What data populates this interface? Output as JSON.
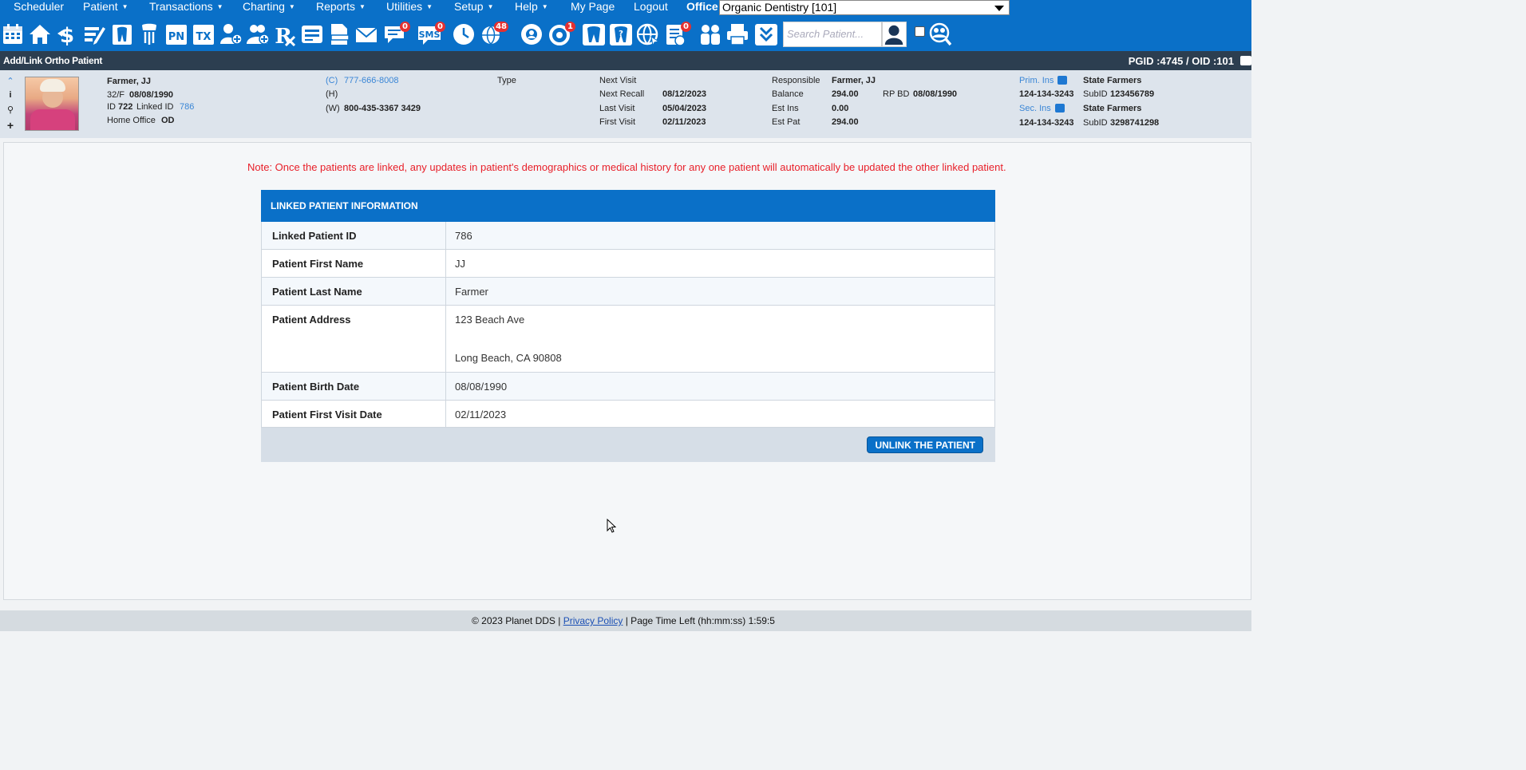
{
  "menu": {
    "items": [
      {
        "label": "Scheduler",
        "caret": false
      },
      {
        "label": "Patient",
        "caret": true
      },
      {
        "label": "Transactions",
        "caret": true
      },
      {
        "label": "Charting",
        "caret": true
      },
      {
        "label": "Reports",
        "caret": true
      },
      {
        "label": "Utilities",
        "caret": true
      },
      {
        "label": "Setup",
        "caret": true
      },
      {
        "label": "Help",
        "caret": true
      },
      {
        "label": "My Page",
        "caret": false
      },
      {
        "label": "Logout",
        "caret": false
      }
    ],
    "office_label": "Office",
    "office_value": "Organic Dentistry [101]"
  },
  "toolbar": {
    "icons": [
      "calendar-icon",
      "home-icon",
      "dollar-icon",
      "edit-icon",
      "tooth-chart-icon",
      "implant-icon",
      "pn-icon",
      "tx-icon",
      "add-patient-icon",
      "family-add-icon",
      "rx-icon",
      "notes-icon",
      "document-icon",
      "mail-icon",
      "chat-icon",
      "sms-icon",
      "clock-icon",
      "globe-users-icon",
      "support-icon",
      "refresh-icon",
      "tooth-icon",
      "tooth-question-icon",
      "web-icon",
      "checklist-icon",
      "people-icon",
      "printer-icon",
      "chevron-down-icon"
    ],
    "pn_text": "PN",
    "tx_text": "TX",
    "sms_text": "SMS",
    "badges": {
      "chat": "0",
      "sms": "0",
      "globe_users": "48",
      "refresh": "1",
      "checklist": "0"
    },
    "search_placeholder": "Search Patient..."
  },
  "title_bar": {
    "title": "Add/Link Ortho Patient",
    "ids": "PGID :4745  /  OID :101"
  },
  "patient": {
    "name": "Farmer, JJ",
    "age_sex": "32/F",
    "dob": "08/08/1990",
    "id_label": "ID",
    "id": "722",
    "linked_label": "Linked ID",
    "linked_id": "786",
    "home_office_label": "Home Office",
    "home_office": "OD",
    "phone_c_label": "(C)",
    "phone_c": "777-666-8008",
    "phone_h_label": "(H)",
    "phone_w_label": "(W)",
    "phone_w": "800-435-3367 3429",
    "type_label": "Type",
    "next_visit_label": "Next Visit",
    "next_recall_label": "Next Recall",
    "next_recall": "08/12/2023",
    "last_visit_label": "Last Visit",
    "last_visit": "05/04/2023",
    "first_visit_label": "First Visit",
    "first_visit": "02/11/2023",
    "responsible_label": "Responsible",
    "responsible": "Farmer, JJ",
    "balance_label": "Balance",
    "balance": "294.00",
    "rp_bd_label": "RP BD",
    "rp_bd": "08/08/1990",
    "est_ins_label": "Est Ins",
    "est_ins": "0.00",
    "est_pat_label": "Est Pat",
    "est_pat": "294.00",
    "prim_ins_label": "Prim. Ins",
    "prim_ins": "State Farmers",
    "prim_id": "124-134-3243",
    "prim_subid_label": "SubID",
    "prim_subid": "123456789",
    "sec_ins_label": "Sec. Ins",
    "sec_ins": "State Farmers",
    "sec_id": "124-134-3243",
    "sec_subid_label": "SubID",
    "sec_subid": "3298741298"
  },
  "note": "Note: Once the patients are linked, any updates in patient's demographics or medical history for any one patient will automatically be updated the other linked patient.",
  "linked_card": {
    "header": "LINKED PATIENT INFORMATION",
    "rows": [
      {
        "label": "Linked Patient ID",
        "value": "786"
      },
      {
        "label": "Patient First Name",
        "value": "JJ"
      },
      {
        "label": "Patient Last Name",
        "value": "Farmer"
      },
      {
        "label": "Patient Address",
        "value": "123 Beach Ave",
        "value2": "Long Beach, CA 90808"
      },
      {
        "label": "Patient Birth Date",
        "value": "08/08/1990"
      },
      {
        "label": "Patient First Visit Date",
        "value": "02/11/2023"
      }
    ],
    "unlink_label": "UNLINK THE PATIENT"
  },
  "footer": {
    "copyright": "© 2023 Planet DDS |",
    "privacy": "Privacy Policy",
    "page_time": "|  Page Time Left (hh:mm:ss) 1:59:5"
  },
  "colors": {
    "brand_blue": "#0a70c8",
    "title_bar": "#2c3e50",
    "note_red": "#e8202a",
    "badge_red": "#e53030"
  }
}
